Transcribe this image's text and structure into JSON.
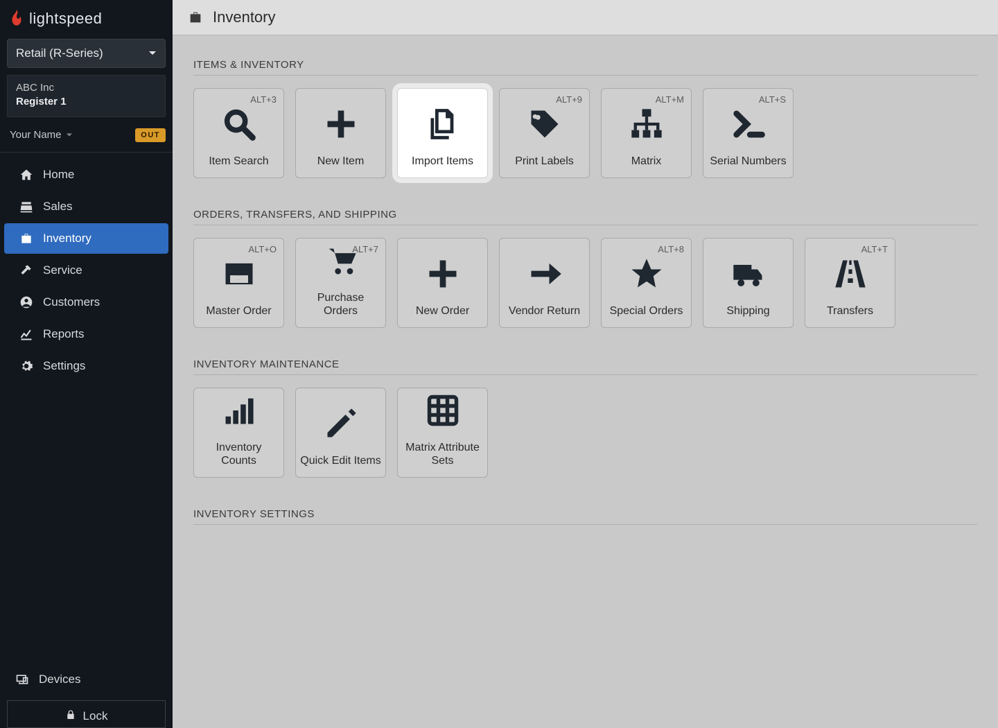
{
  "brand": "lightspeed",
  "series_selector": "Retail (R-Series)",
  "company": {
    "name": "ABC Inc",
    "register": "Register 1"
  },
  "user": {
    "name": "Your Name",
    "status_pill": "OUT"
  },
  "nav": [
    {
      "label": "Home",
      "icon": "home-icon"
    },
    {
      "label": "Sales",
      "icon": "register-icon"
    },
    {
      "label": "Inventory",
      "icon": "briefcase-icon",
      "active": true
    },
    {
      "label": "Service",
      "icon": "hammer-icon"
    },
    {
      "label": "Customers",
      "icon": "user-circle-icon"
    },
    {
      "label": "Reports",
      "icon": "chart-line-icon"
    },
    {
      "label": "Settings",
      "icon": "gear-icon"
    }
  ],
  "devices_label": "Devices",
  "lock_label": "Lock",
  "page_title": "Inventory",
  "sections": [
    {
      "title": "ITEMS & INVENTORY",
      "tiles": [
        {
          "label": "Item Search",
          "shortcut": "ALT+3",
          "icon": "search-icon"
        },
        {
          "label": "New Item",
          "shortcut": "",
          "icon": "plus-icon"
        },
        {
          "label": "Import Items",
          "shortcut": "",
          "icon": "copy-files-icon",
          "highlight": true
        },
        {
          "label": "Print Labels",
          "shortcut": "ALT+9",
          "icon": "tag-icon"
        },
        {
          "label": "Matrix",
          "shortcut": "ALT+M",
          "icon": "sitemap-icon"
        },
        {
          "label": "Serial Numbers",
          "shortcut": "ALT+S",
          "icon": "terminal-icon"
        }
      ]
    },
    {
      "title": "ORDERS, TRANSFERS, AND SHIPPING",
      "tiles": [
        {
          "label": "Master Order",
          "shortcut": "ALT+O",
          "icon": "inbox-icon"
        },
        {
          "label": "Purchase Orders",
          "shortcut": "ALT+7",
          "icon": "cart-icon"
        },
        {
          "label": "New Order",
          "shortcut": "",
          "icon": "plus-icon"
        },
        {
          "label": "Vendor Return",
          "shortcut": "",
          "icon": "arrow-right-icon"
        },
        {
          "label": "Special Orders",
          "shortcut": "ALT+8",
          "icon": "star-icon"
        },
        {
          "label": "Shipping",
          "shortcut": "",
          "icon": "truck-icon"
        },
        {
          "label": "Transfers",
          "shortcut": "ALT+T",
          "icon": "road-icon"
        }
      ]
    },
    {
      "title": "INVENTORY MAINTENANCE",
      "tiles": [
        {
          "label": "Inventory Counts",
          "shortcut": "",
          "icon": "bars-icon"
        },
        {
          "label": "Quick Edit Items",
          "shortcut": "",
          "icon": "pencil-icon"
        },
        {
          "label": "Matrix Attribute Sets",
          "shortcut": "",
          "icon": "grid-icon"
        }
      ]
    },
    {
      "title": "INVENTORY SETTINGS",
      "tiles": []
    }
  ]
}
